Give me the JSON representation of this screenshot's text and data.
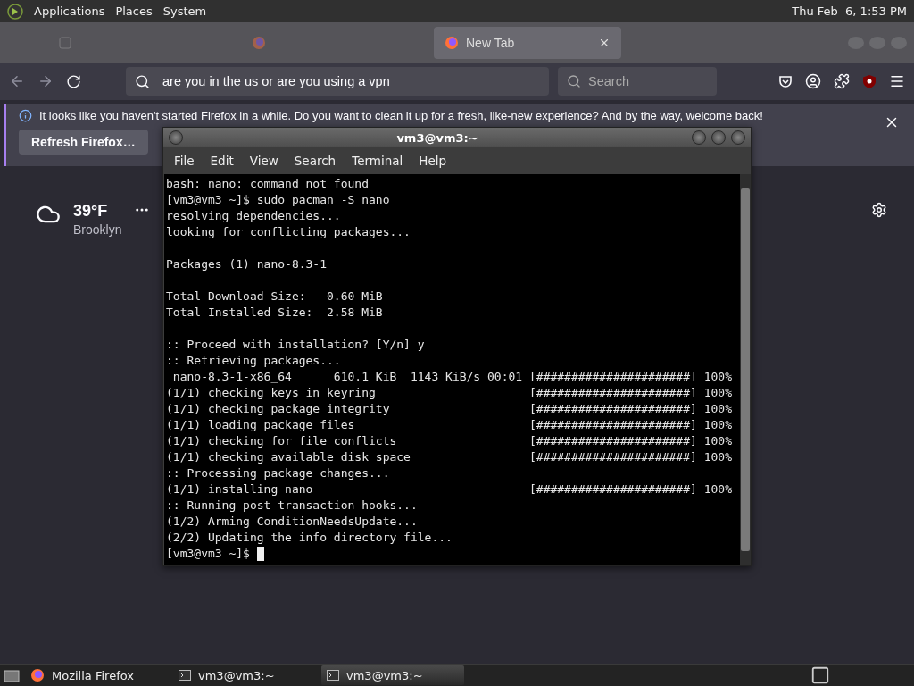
{
  "top_panel": {
    "menus": [
      "Applications",
      "Places",
      "System"
    ],
    "clock": "Thu Feb  6, 1:53 PM"
  },
  "browser": {
    "tabs": [
      {
        "selected": false,
        "kind": "blank"
      },
      {
        "selected": false,
        "kind": "firefox"
      },
      {
        "selected": true,
        "kind": "firefox",
        "label": "New Tab"
      }
    ],
    "address_bar": {
      "value": "are you in the us or are you using a vpn"
    },
    "search_field": {
      "placeholder": "Search"
    },
    "notification": {
      "message": "It looks like you haven't started Firefox in a while. Do you want to clean it up for a fresh, like-new experience? And by the way, welcome back!",
      "button": "Refresh Firefox…"
    },
    "weather": {
      "temperature": "39°F",
      "location": "Brooklyn"
    }
  },
  "terminal": {
    "title": "vm3@vm3:~",
    "menus": [
      "File",
      "Edit",
      "View",
      "Search",
      "Terminal",
      "Help"
    ],
    "paragraphs": [
      [
        "bash: nano: command not found",
        "[vm3@vm3 ~]$ sudo pacman -S nano",
        "resolving dependencies...",
        "looking for conflicting packages..."
      ],
      [
        "Packages (1) nano-8.3-1"
      ],
      [
        "Total Download Size:   0.60 MiB",
        "Total Installed Size:  2.58 MiB"
      ],
      [
        ":: Proceed with installation? [Y/n] y",
        ":: Retrieving packages...",
        " nano-8.3-1-x86_64      610.1 KiB  1143 KiB/s 00:01 [######################] 100%",
        "(1/1) checking keys in keyring                      [######################] 100%",
        "(1/1) checking package integrity                    [######################] 100%",
        "(1/1) loading package files                         [######################] 100%",
        "(1/1) checking for file conflicts                   [######################] 100%",
        "(1/1) checking available disk space                 [######################] 100%",
        ":: Processing package changes...",
        "(1/1) installing nano                               [######################] 100%",
        ":: Running post-transaction hooks...",
        "(1/2) Arming ConditionNeedsUpdate...",
        "(2/2) Updating the info directory file..."
      ]
    ],
    "prompt": "[vm3@vm3 ~]$ "
  },
  "taskbar": {
    "items": [
      {
        "label": "Mozilla Firefox",
        "kind": "browser",
        "selected": false
      },
      {
        "label": "vm3@vm3:~",
        "kind": "terminal",
        "selected": false
      },
      {
        "label": "vm3@vm3:~",
        "kind": "terminal",
        "selected": true
      }
    ]
  }
}
